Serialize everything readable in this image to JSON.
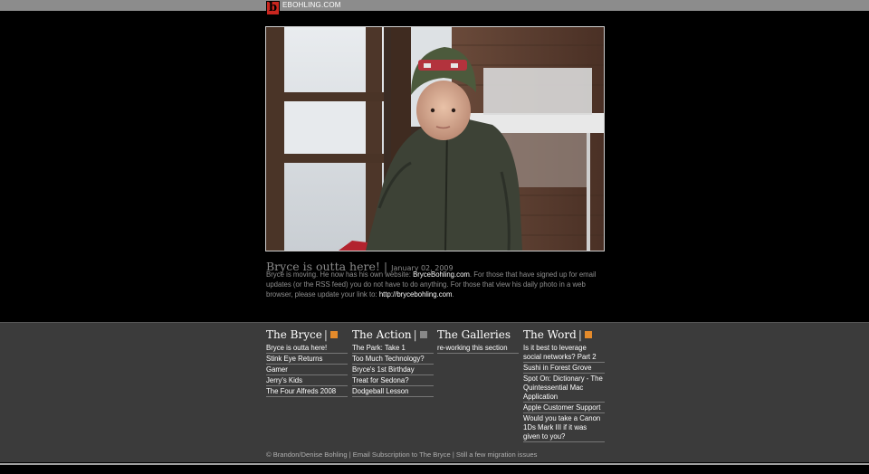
{
  "header": {
    "logo_letter": "b",
    "site_name": "EBOHLING.COM"
  },
  "post": {
    "title": "Bryce is outta here!",
    "separator": "|",
    "date": "January 02, 2009",
    "body_1": "Bryce is moving. He now has his own website: ",
    "link_1": "BryceBohling.com",
    "body_2": ". For those that have signed up for email updates (or the RSS feed) you do not have to do anything. For those that view his daily photo in a web browser, please update your link to: ",
    "link_2": "http://brycebohling.com",
    "body_3": "."
  },
  "footer": {
    "separator": "|",
    "columns": [
      {
        "heading": "The Bryce",
        "rss": true,
        "items": [
          "Bryce is outta here!",
          "Stink Eye Returns",
          "Gamer",
          "Jerry's Kids",
          "The Four Alfreds 2008"
        ]
      },
      {
        "heading": "The Action",
        "rss": true,
        "items": [
          "The Park: Take 1",
          "Too Much Technology?",
          "Bryce's 1st Birthday",
          "Treat for Sedona?",
          "Dodgeball Lesson"
        ]
      },
      {
        "heading": "The Galleries",
        "rss": false,
        "items": [
          "re-working this section"
        ]
      },
      {
        "heading": "The Word",
        "rss": true,
        "items": [
          "Is it best to leverage social networks? Part 2",
          "Sushi in Forest Grove",
          "Spot On: Dictionary - The Quintessential Mac Application",
          "Apple Customer Support",
          "Would you take a Canon 1Ds Mark III if it was given to you?"
        ]
      }
    ],
    "copyright": "© Brandon/Denise Bohling | Email Subscription to The Bryce | Still a few migration issues"
  },
  "colors": {
    "background": "#000000",
    "footer_bg": "#3b3b3b",
    "logo_red": "#c9261f",
    "rss_orange": "#e58b2b"
  }
}
